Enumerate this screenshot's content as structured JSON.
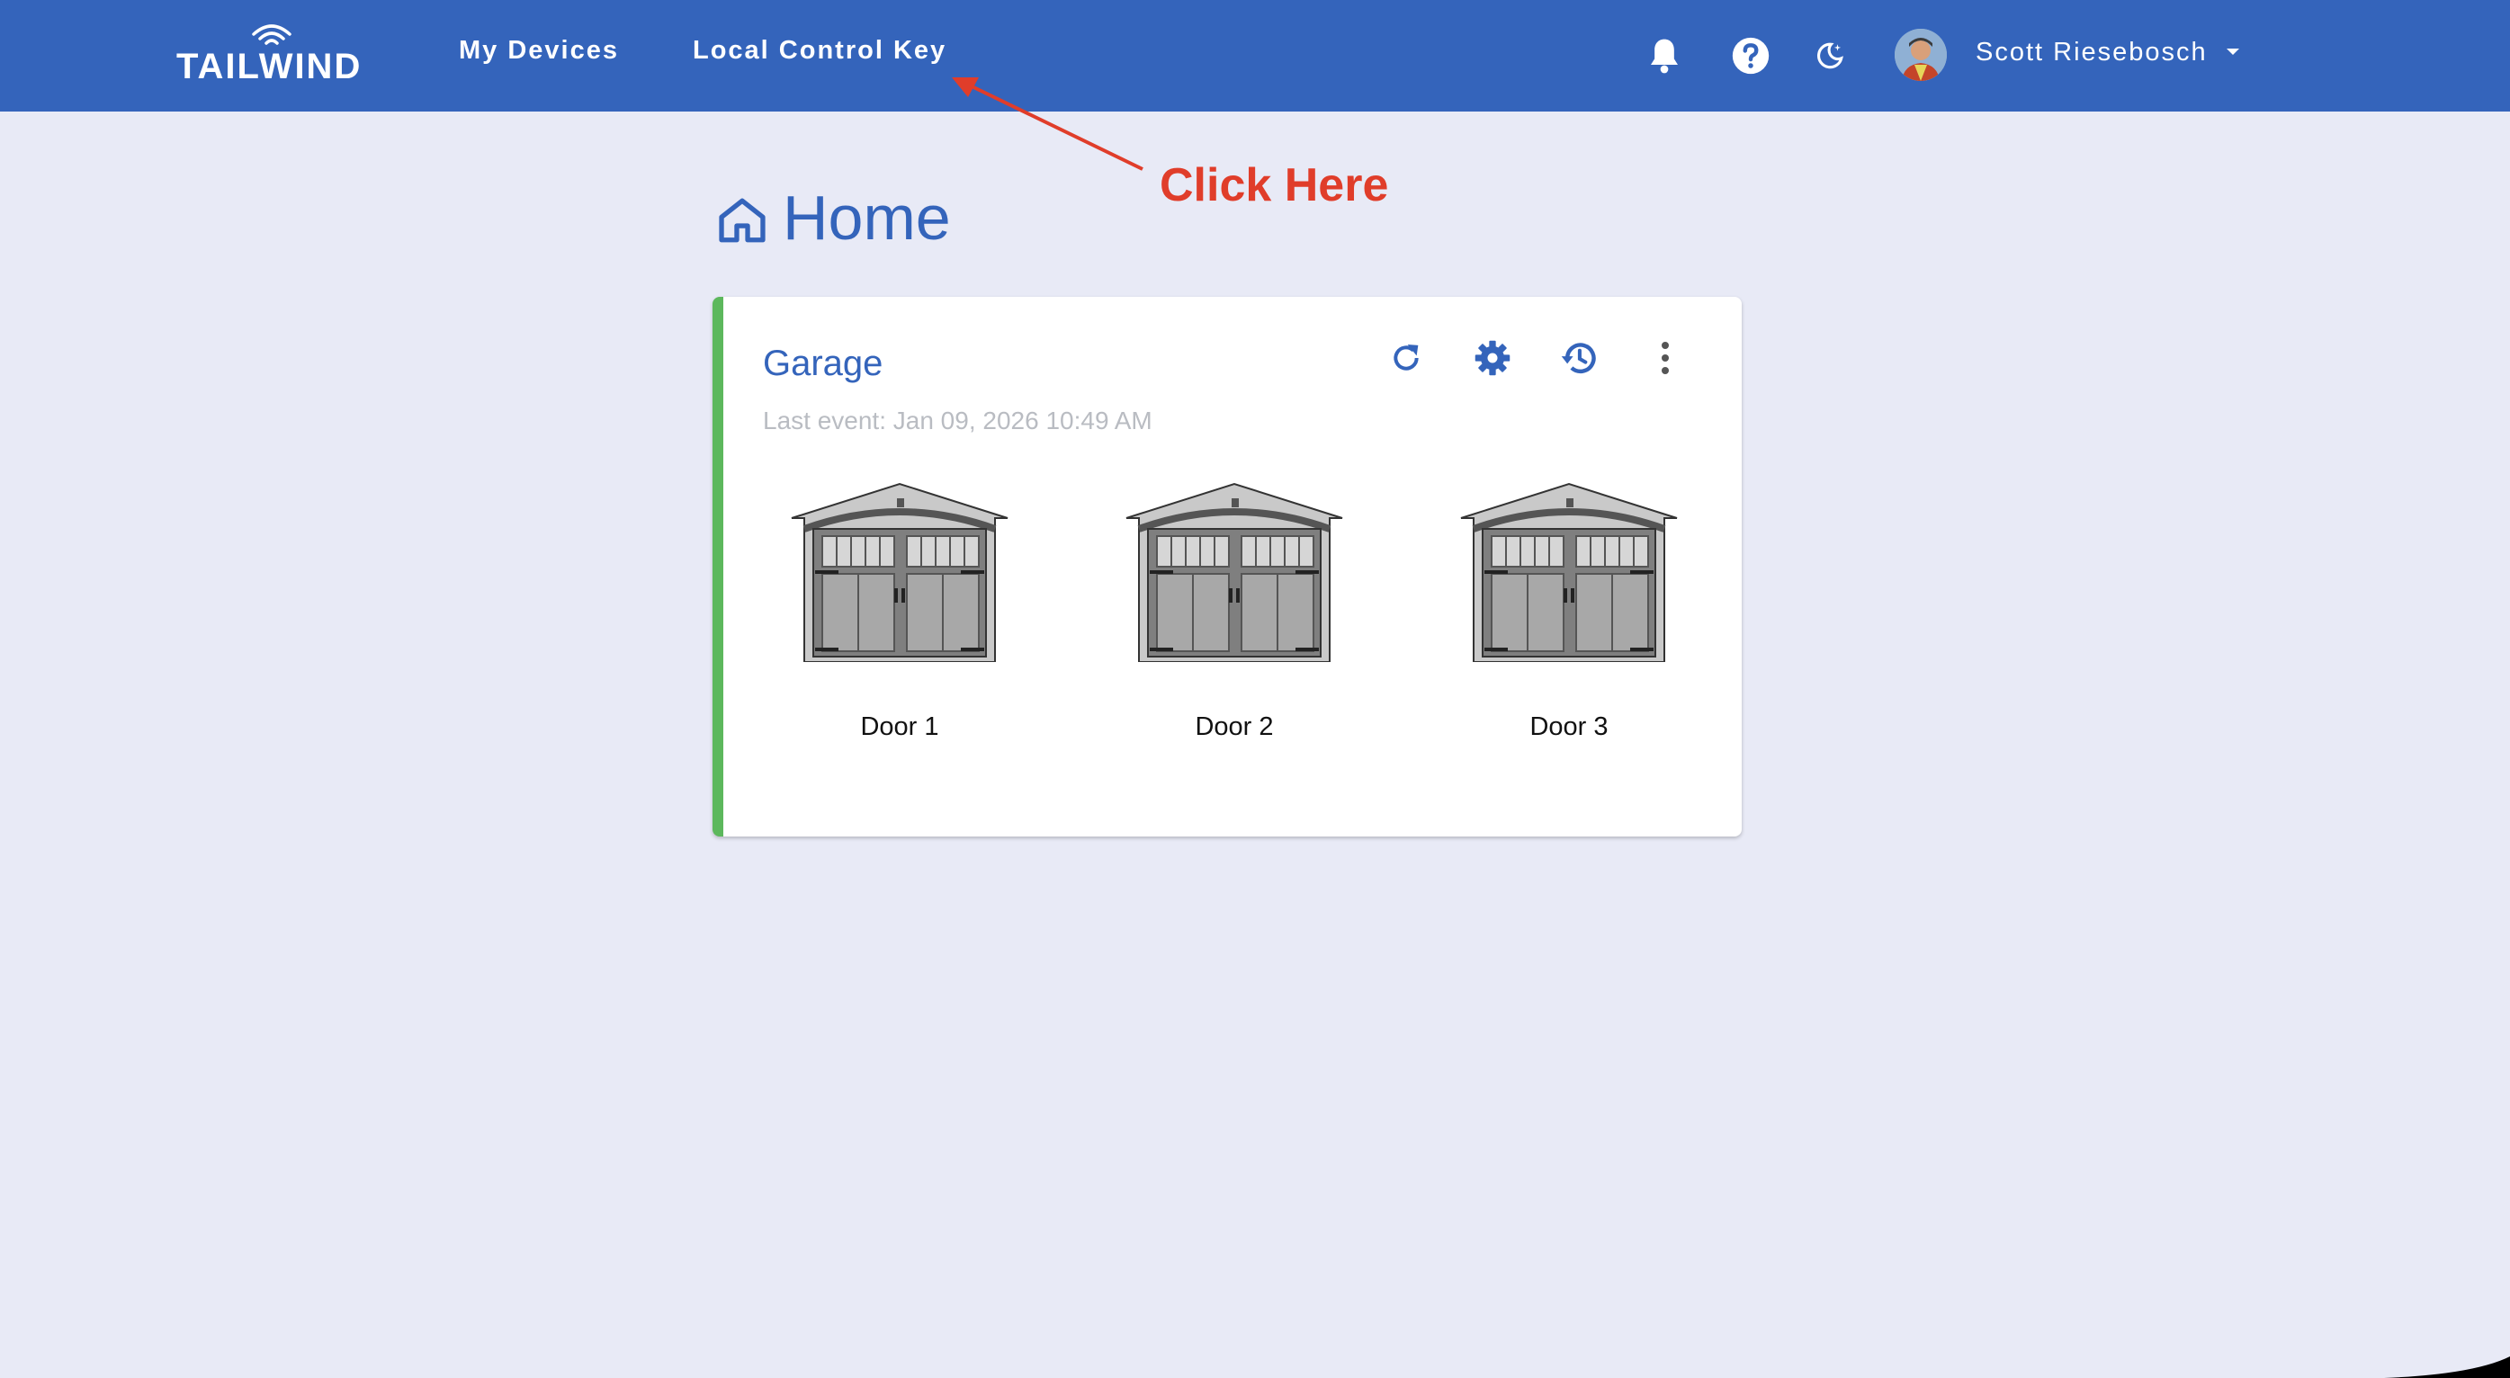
{
  "brand": {
    "logo_text": "TAILWIND"
  },
  "nav": {
    "my_devices": "My Devices",
    "local_control_key": "Local Control Key"
  },
  "header_icons": [
    "bell-icon",
    "help-icon",
    "moon-icon"
  ],
  "user": {
    "name": "Scott Riesebosch"
  },
  "annotation": {
    "text": "Click Here",
    "color": "#e03d2a"
  },
  "page": {
    "title": "Home"
  },
  "device_card": {
    "name": "Garage",
    "last_event": "Last event: Jan 09, 2026 10:49 AM",
    "status_color": "#5cb85c",
    "actions": [
      "refresh-icon",
      "settings-icon",
      "history-icon",
      "more-icon"
    ],
    "doors": [
      {
        "label": "Door 1"
      },
      {
        "label": "Door 2"
      },
      {
        "label": "Door 3"
      }
    ]
  },
  "colors": {
    "primary": "#3464bb",
    "background": "#e8eaf6",
    "card": "#ffffff"
  }
}
